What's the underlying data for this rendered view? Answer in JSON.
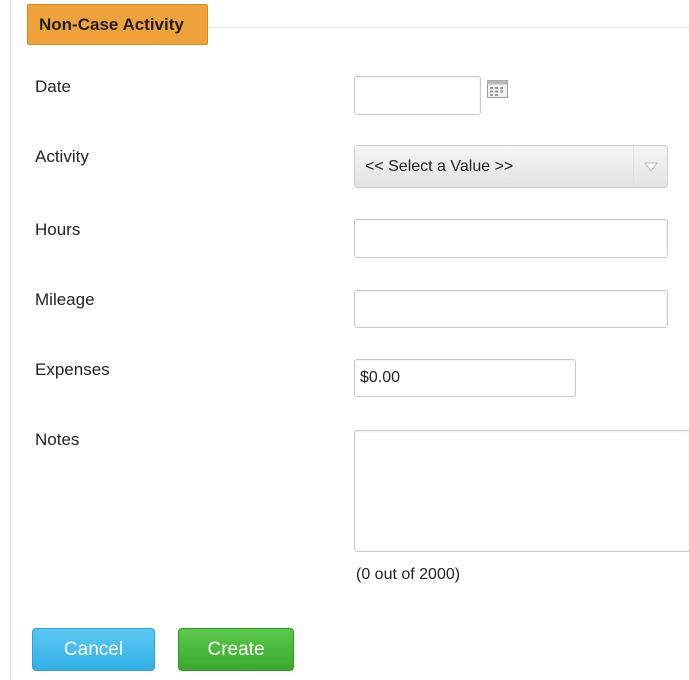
{
  "form": {
    "tab_title": "Non-Case Activity",
    "fields": {
      "date": {
        "label": "Date",
        "value": ""
      },
      "activity": {
        "label": "Activity",
        "selected": "<< Select a Value >>"
      },
      "hours": {
        "label": "Hours",
        "value": ""
      },
      "mileage": {
        "label": "Mileage",
        "value": ""
      },
      "expenses": {
        "label": "Expenses",
        "value": "$0.00"
      },
      "notes": {
        "label": "Notes",
        "value": "",
        "counter": "(0 out of 2000)"
      }
    },
    "icons": {
      "calendar": "calendar-icon",
      "dropdown": "chevron-down-icon"
    },
    "buttons": {
      "cancel": "Cancel",
      "create": "Create"
    },
    "colors": {
      "tab": "#f0a23a",
      "cancel": "#33b0e6",
      "create": "#3aa82c"
    }
  }
}
